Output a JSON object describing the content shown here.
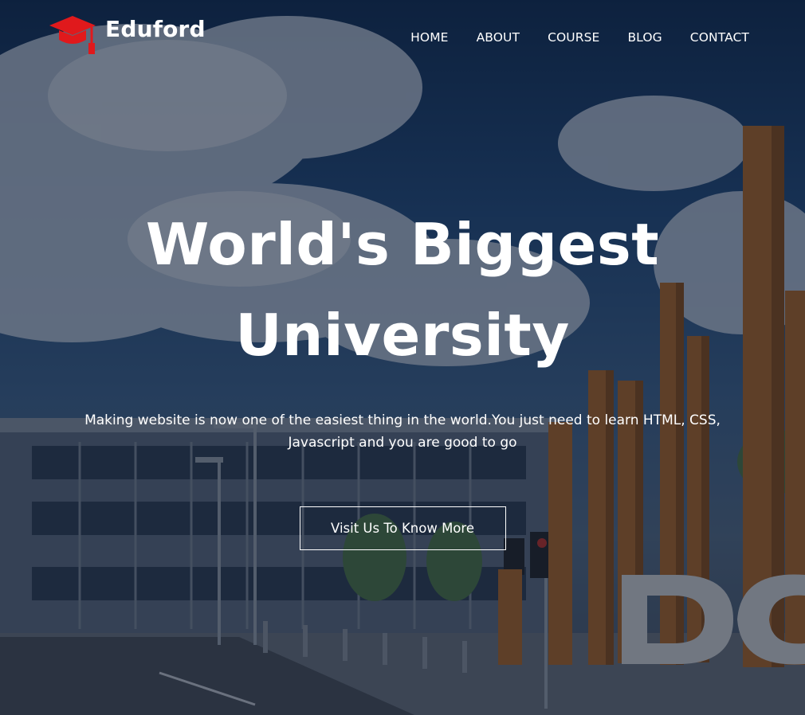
{
  "brand": {
    "name": "Eduford",
    "logo_icon": "graduation-cap-icon",
    "logo_color": "#e0191c"
  },
  "nav": {
    "items": [
      {
        "label": "HOME"
      },
      {
        "label": "ABOUT"
      },
      {
        "label": "COURSE"
      },
      {
        "label": "BLOG"
      },
      {
        "label": "CONTACT"
      }
    ]
  },
  "hero": {
    "title_line1": "World's Biggest",
    "title_line2": "University",
    "subtitle": "Making website is now one of the easiest thing in the world.You just need to learn HTML, CSS, Javascript and you are good to go",
    "button_label": "Visit Us To Know More",
    "overlay_color": "#0c1426"
  }
}
